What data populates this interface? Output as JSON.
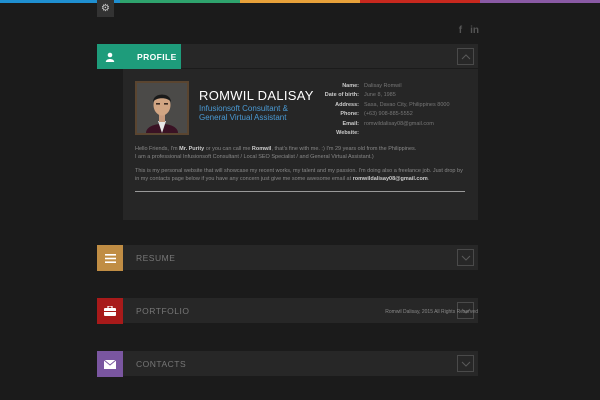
{
  "colors": {
    "topbar": [
      "#1f8fd1",
      "#2ea36d",
      "#e8a13a",
      "#c8281e",
      "#8a5aa5"
    ],
    "profile": "#1e9c7b",
    "resume": "#c08d44",
    "portfolio": "#a81a1a",
    "contacts": "#7a56a0"
  },
  "settings": {
    "icon": "gear-icon"
  },
  "social": [
    {
      "label": "f",
      "icon": "facebook-icon"
    },
    {
      "label": "in",
      "icon": "linkedin-icon"
    }
  ],
  "profile": {
    "label": "PROFILE",
    "name": "ROMWIL DALISAY",
    "title_line1": "Infusionsoft Consultant &",
    "title_line2": "General Virtual Assistant",
    "info": [
      {
        "key": "Name:",
        "value": "Dalisay Romwil"
      },
      {
        "key": "Date of birth:",
        "value": "June 8, 1985"
      },
      {
        "key": "Address:",
        "value": "Sasa, Davao City, Philippines 8000"
      },
      {
        "key": "Phone:",
        "value": "(+63) 908-885-5552"
      },
      {
        "key": "Email:",
        "value": "romwildalisay08@gmail.com"
      },
      {
        "key": "Website:",
        "value": ""
      }
    ],
    "bio": {
      "p1_a": "Hello Friends, I'm ",
      "p1_b": "Mr. Purity",
      "p1_c": " or you can call me ",
      "p1_d": "Romwil",
      "p1_e": ", that's fine with me. :) I'm 29 years old from the Philippines.",
      "p1_f": "I am a professional Infusionsoft Consultant / Local SEO Specialist / and General Virtual Assistant.)",
      "p2_a": "This is my personal website that will showcase my recent works, my talent and my passion. I'm doing also a freelance job. Just drop by in my contacts page below if you have any concern just give me some awesome email at ",
      "p2_b": "romwildalisay08@gmail.com",
      "p2_c": "."
    }
  },
  "sections": {
    "resume": "RESUME",
    "portfolio": "PORTFOLIO",
    "contacts": "CONTACTS"
  },
  "footer": "Romwil Dalisay, 2015 All Rights Reserved"
}
